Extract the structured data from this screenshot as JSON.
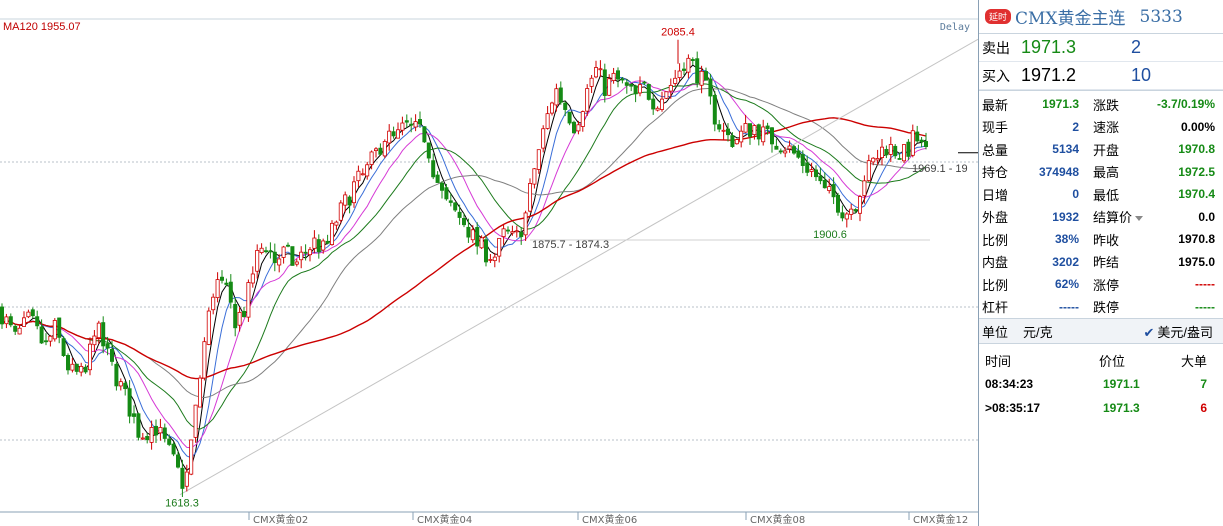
{
  "chart": {
    "ma_label": "MA120 1955.07",
    "delay": "Delay",
    "price_label_right": "1969.1 - 19"
  },
  "chart_data": {
    "type": "candlestick",
    "y_range": [
      1600,
      2110
    ],
    "x_tick_labels": [
      "CMX黄金02",
      "CMX黄金04",
      "CMX黄金06",
      "CMX黄金08",
      "CMX黄金12"
    ],
    "annotations": [
      {
        "text": "2085.4",
        "price": 2085.4,
        "kind": "high"
      },
      {
        "text": "1618.3",
        "price": 1618.3,
        "kind": "low"
      },
      {
        "text": "1900.6",
        "price": 1900.6,
        "kind": "low"
      },
      {
        "text": "1875.7 - 1874.3",
        "price": 1875.7,
        "kind": "level"
      }
    ],
    "reference_price": 1971.3,
    "path": [
      [
        0,
        1810
      ],
      [
        15,
        1780
      ],
      [
        30,
        1800
      ],
      [
        45,
        1770
      ],
      [
        55,
        1790
      ],
      [
        70,
        1745
      ],
      [
        85,
        1740
      ],
      [
        95,
        1795
      ],
      [
        110,
        1755
      ],
      [
        125,
        1720
      ],
      [
        140,
        1680
      ],
      [
        155,
        1690
      ],
      [
        170,
        1660
      ],
      [
        185,
        1625
      ],
      [
        195,
        1700
      ],
      [
        205,
        1780
      ],
      [
        215,
        1840
      ],
      [
        225,
        1830
      ],
      [
        235,
        1800
      ],
      [
        245,
        1810
      ],
      [
        255,
        1860
      ],
      [
        265,
        1880
      ],
      [
        275,
        1860
      ],
      [
        285,
        1870
      ],
      [
        295,
        1855
      ],
      [
        305,
        1870
      ],
      [
        315,
        1880
      ],
      [
        325,
        1870
      ],
      [
        335,
        1900
      ],
      [
        345,
        1920
      ],
      [
        355,
        1940
      ],
      [
        365,
        1950
      ],
      [
        375,
        1970
      ],
      [
        385,
        1990
      ],
      [
        395,
        1985
      ],
      [
        405,
        2000
      ],
      [
        415,
        1995
      ],
      [
        425,
        1990
      ],
      [
        435,
        1950
      ],
      [
        445,
        1920
      ],
      [
        455,
        1910
      ],
      [
        465,
        1900
      ],
      [
        475,
        1880
      ],
      [
        485,
        1870
      ],
      [
        495,
        1865
      ],
      [
        505,
        1890
      ],
      [
        515,
        1880
      ],
      [
        525,
        1905
      ],
      [
        535,
        1960
      ],
      [
        545,
        2000
      ],
      [
        555,
        2040
      ],
      [
        565,
        2020
      ],
      [
        575,
        2000
      ],
      [
        585,
        2030
      ],
      [
        595,
        2060
      ],
      [
        605,
        2040
      ],
      [
        615,
        2050
      ],
      [
        625,
        2040
      ],
      [
        635,
        2030
      ],
      [
        645,
        2040
      ],
      [
        655,
        2025
      ],
      [
        665,
        2035
      ],
      [
        675,
        2050
      ],
      [
        685,
        2070
      ],
      [
        695,
        2060
      ],
      [
        705,
        2040
      ],
      [
        715,
        2010
      ],
      [
        725,
        1990
      ],
      [
        735,
        1985
      ],
      [
        745,
        1995
      ],
      [
        755,
        2000
      ],
      [
        765,
        1990
      ],
      [
        775,
        1985
      ],
      [
        785,
        1980
      ],
      [
        795,
        1970
      ],
      [
        805,
        1960
      ],
      [
        815,
        1950
      ],
      [
        825,
        1930
      ],
      [
        835,
        1925
      ],
      [
        845,
        1910
      ],
      [
        855,
        1920
      ],
      [
        865,
        1950
      ],
      [
        875,
        1965
      ],
      [
        885,
        1980
      ],
      [
        895,
        1975
      ],
      [
        905,
        1970
      ],
      [
        915,
        1990
      ],
      [
        925,
        1971
      ]
    ],
    "ma_series": [
      {
        "color": "#000000",
        "window": 4
      },
      {
        "color": "#3a6ed8",
        "window": 7
      },
      {
        "color": "#d63ad6",
        "window": 12
      },
      {
        "color": "#1c7a1c",
        "window": 20
      },
      {
        "color": "#808080",
        "window": 34
      },
      {
        "color": "#cc0000",
        "window": 70
      }
    ]
  },
  "panel": {
    "badge": "延时",
    "title": "CMX黄金主连",
    "code": "5333",
    "sell": {
      "label": "卖出",
      "price": "1971.3",
      "volume": "2"
    },
    "buy": {
      "label": "买入",
      "price": "1971.2",
      "volume": "10"
    },
    "stats": [
      {
        "l1": "最新",
        "v1": "1971.3",
        "c1": "green",
        "l2": "涨跌",
        "v2": "-3.7/0.19%",
        "c2": "green"
      },
      {
        "l1": "现手",
        "v1": "2",
        "c1": "blue",
        "l2": "速涨",
        "v2": "0.00%",
        "c2": "blk"
      },
      {
        "l1": "总量",
        "v1": "5134",
        "c1": "blue",
        "l2": "开盘",
        "v2": "1970.8",
        "c2": "green"
      },
      {
        "l1": "持仓",
        "v1": "374948",
        "c1": "blue",
        "l2": "最高",
        "v2": "1972.5",
        "c2": "green"
      },
      {
        "l1": "日增",
        "v1": "0",
        "c1": "blue",
        "l2": "最低",
        "v2": "1970.4",
        "c2": "green"
      },
      {
        "l1": "外盘",
        "v1": "1932",
        "c1": "blue",
        "l2": "结算价",
        "v2": "0.0",
        "c2": "blk"
      },
      {
        "l1": "比例",
        "v1": "38%",
        "c1": "blue",
        "l2": "昨收",
        "v2": "1970.8",
        "c2": "blk"
      },
      {
        "l1": "内盘",
        "v1": "3202",
        "c1": "blue",
        "l2": "昨结",
        "v2": "1975.0",
        "c2": "blk"
      },
      {
        "l1": "比例",
        "v1": "62%",
        "c1": "blue",
        "l2": "涨停",
        "v2": "-----",
        "c2": "red"
      },
      {
        "l1": "杠杆",
        "v1": "-----",
        "c1": "blue",
        "l2": "跌停",
        "v2": "-----",
        "c2": "green"
      }
    ],
    "unit": {
      "label": "单位",
      "value": "元/克",
      "option": "美元/盎司"
    },
    "ticks_header": {
      "time": "时间",
      "price": "价位",
      "volume": "大单"
    },
    "ticks": [
      {
        "time": "08:34:23",
        "price": "1971.1",
        "volume": "7",
        "side": "sell"
      },
      {
        "time": ">08:35:17",
        "price": "1971.3",
        "volume": "6",
        "side": "buy"
      }
    ]
  },
  "colors": {
    "up": "#d00000",
    "down": "#158a15",
    "accent": "#3a6ea5"
  }
}
